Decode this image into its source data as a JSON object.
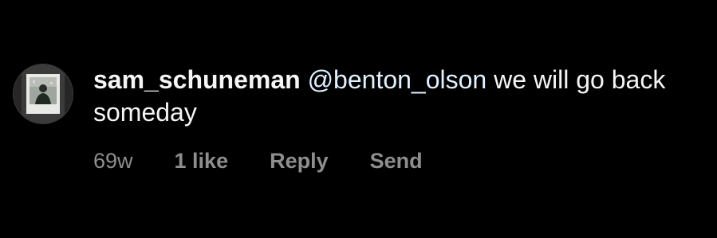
{
  "comment": {
    "avatar_icon": "profile-photo-avatar",
    "username": "sam_schuneman",
    "mention": "@benton_olson",
    "text": "we will go back someday",
    "meta": {
      "age": "69w",
      "likes": "1 like",
      "reply_label": "Reply",
      "send_label": "Send"
    }
  },
  "colors": {
    "background": "#000000",
    "primary_text": "#f5f5f5",
    "mention": "#e0f1ff",
    "meta_text": "#8e8e8e"
  }
}
